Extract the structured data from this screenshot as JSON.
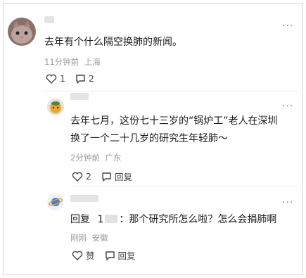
{
  "comments": [
    {
      "text": "去年有个什么隔空换肺的新闻。",
      "time": "11分钟前",
      "location": "上海",
      "likes": "1",
      "replies": "2"
    },
    {
      "text_line1": "去年七月，这份七十三岁的“锅炉工”老人在深圳",
      "text_line2": "换了一个二十几岁的研究生年轻肺～",
      "time": "2分钟前",
      "location": "广东",
      "likes": "2",
      "reply_label": "回复"
    },
    {
      "reply_prefix": "回复",
      "reply_to": "1",
      "text": "：那个研究所怎么啦？怎么会捐肺啊",
      "time": "刚刚",
      "location": "安徽",
      "like_label": "赞",
      "reply_label": "回复"
    }
  ],
  "colors": {
    "border": "#d6d6d6",
    "meta": "#9a9a9a",
    "icon": "#555555"
  }
}
